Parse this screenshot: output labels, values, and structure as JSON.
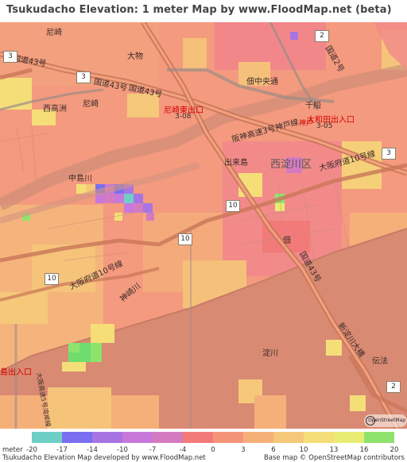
{
  "title": "Tsukudacho Elevation: 1 meter Map by www.FloodMap.net (beta)",
  "map": {
    "labels": [
      "尼崎",
      "大物",
      "尼崎",
      "西高洲",
      "千船",
      "佃中央通",
      "出来島",
      "西淀川区",
      "中島川",
      "大阪府道10号線",
      "神崎川",
      "淀川",
      "島出入口",
      "大阪高速5号湾岸線",
      "伝法",
      "国道43号",
      "国道43号",
      "国道43号",
      "国道2号",
      "国道43号",
      "阪神高速3号神戸線",
      "大阪府道10号線",
      "新淀川大橋",
      "佃"
    ],
    "ramp_labels": [
      {
        "name": "amagasaki-exit",
        "text": "尼崎東出口",
        "code": "3-08"
      },
      {
        "name": "oowada-exit",
        "text": "大和田出入口",
        "code": "3-05"
      },
      {
        "name": "kobe-exit",
        "text": "神戸"
      }
    ],
    "shields": [
      "2",
      "3",
      "3",
      "3",
      "10",
      "10",
      "10",
      "2"
    ],
    "osm_logo_text": "OpenStreetMap"
  },
  "legend": {
    "unit_label": "meter",
    "ticks": [
      "-20",
      "-17",
      "-14",
      "-10",
      "-7",
      "-4",
      "0",
      "3",
      "6",
      "10",
      "13",
      "16",
      "20"
    ],
    "colors": [
      "#6fcfc7",
      "#7a6ff0",
      "#a874e3",
      "#c878d9",
      "#d47bc0",
      "#f27a78",
      "#f49478",
      "#f5b07a",
      "#f5c87a",
      "#f5de78",
      "#e8ec72",
      "#8ee36c",
      "#6fdc6e"
    ],
    "footer_left": "Tsukudacho Elevation Map developed by www.FloodMap.net",
    "footer_right": "Base map © OpenStreetMap contributors"
  }
}
